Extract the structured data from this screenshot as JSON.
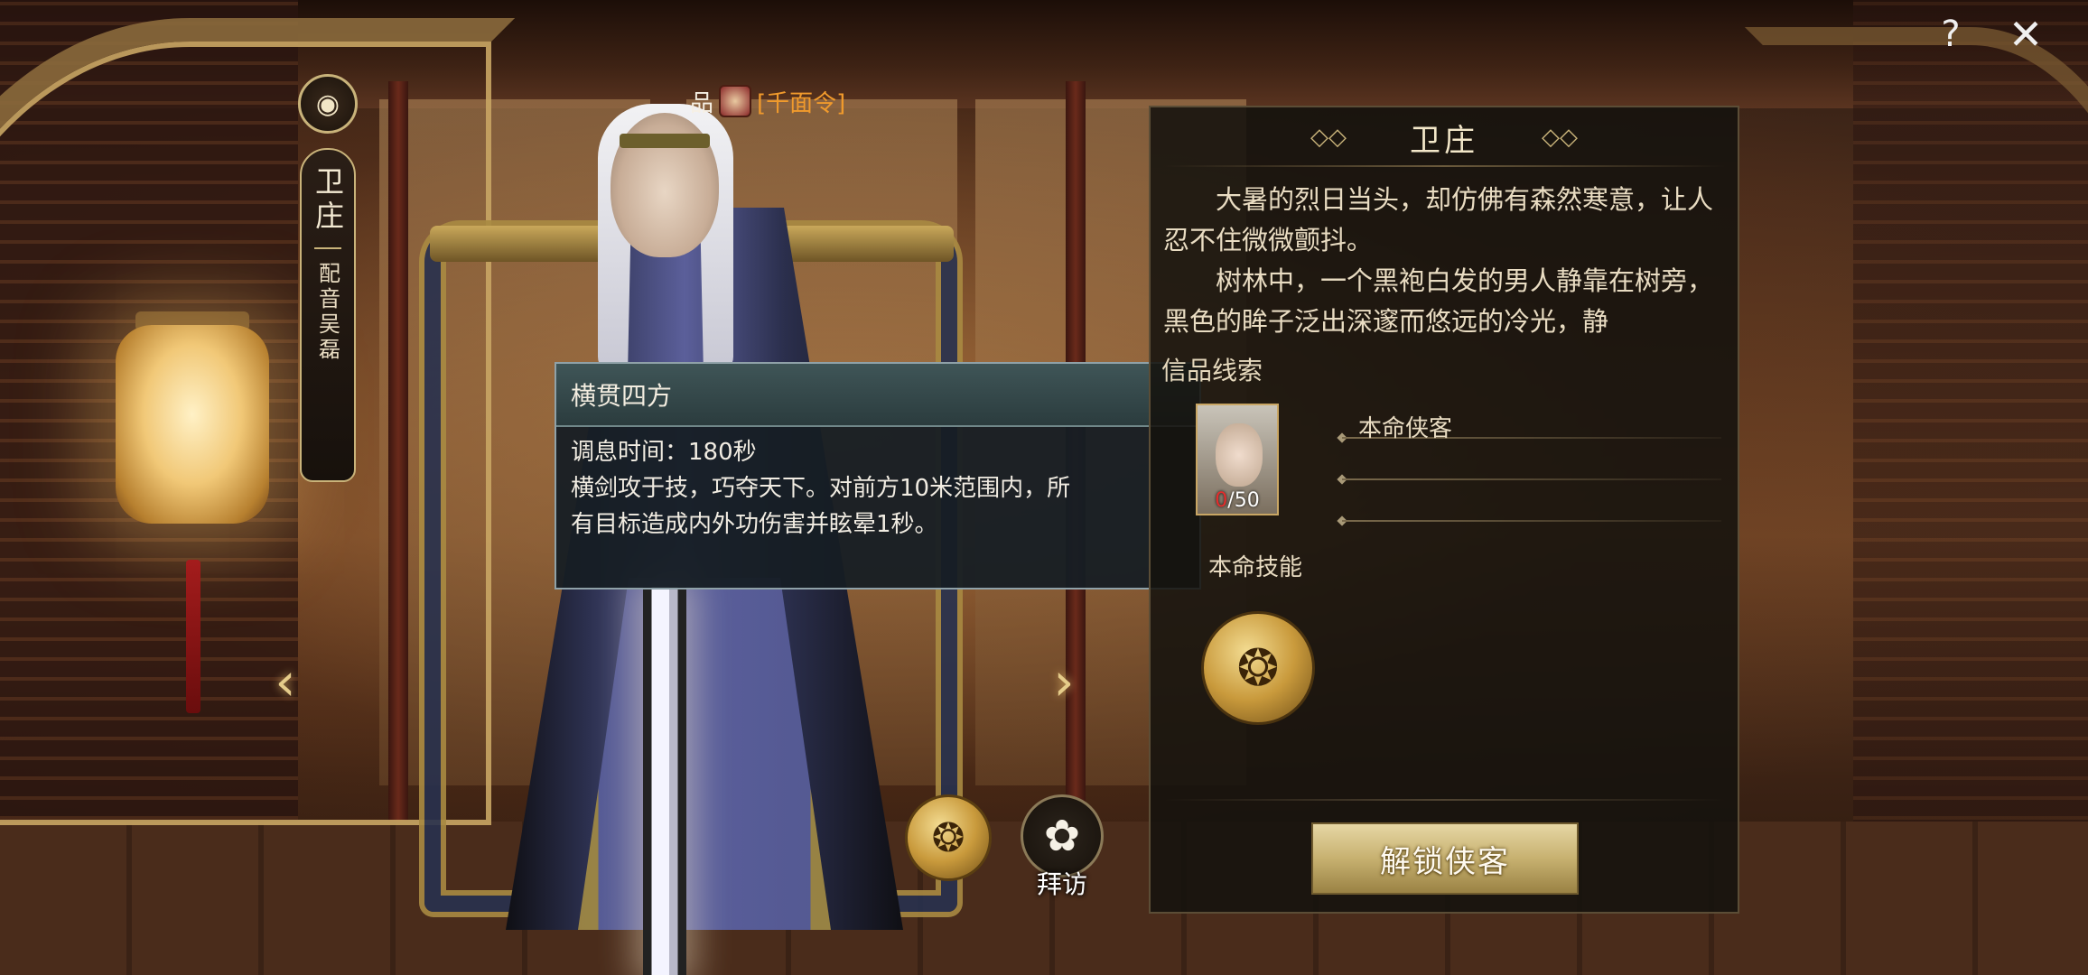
{
  "hero": {
    "name": "卫庄",
    "voice_actor": "配音吴磊",
    "title_prefix": "品",
    "title_tag": "[千面令]"
  },
  "tooltip": {
    "title": "横贯四方",
    "cooldown": "调息时间：180秒",
    "desc_line1": "横剑攻于技，巧夺天下。对前方10米范围内，所",
    "desc_line2": "有目标造成内外功伤害并眩晕1秒。"
  },
  "actions": {
    "visit_label": "拜访"
  },
  "panel": {
    "title": "卫庄",
    "story_p1": "大暑的烈日当头，却仿佛有森然寒意，让人忍不住微微颤抖。",
    "story_p2": "树林中，一个黑袍白发的男人静靠在树旁，黑色的眸子泛出深邃而悠远的冷光，静",
    "clue_label": "信品线索",
    "shard_have": "0",
    "shard_need": "/50",
    "clue_1": "本命侠客",
    "skill_label": "本命技能",
    "unlock_button": "解锁侠客"
  },
  "icons": {
    "voice": "speaker-wave-icon",
    "arrow_left": "chevron-left-icon",
    "arrow_right": "chevron-right-icon",
    "help": "question-icon",
    "close": "close-icon",
    "visit": "flower-icon",
    "skill": "sword-skill-icon"
  },
  "colors": {
    "accent_gold": "#c9b37a",
    "tag_orange": "#f09a2c",
    "shard_red": "#e62c2c"
  }
}
